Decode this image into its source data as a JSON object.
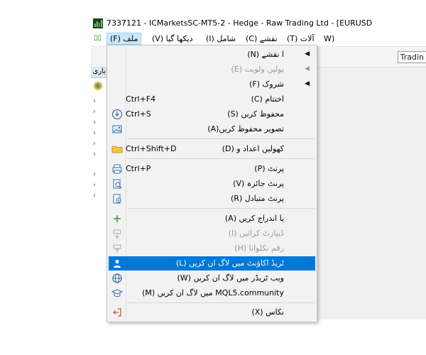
{
  "window": {
    "title": "7337121 - ICMarketsSC-MT5-2 - Hedge - Raw Trading Ltd - [EURUSD"
  },
  "menubar": {
    "items": [
      {
        "label": "ملف (F)",
        "active": true
      },
      {
        "label": "دیکھا گیا (V)"
      },
      {
        "label": "شامل (I)"
      },
      {
        "label": "نقشے (C)"
      },
      {
        "label": "آلات (T)"
      },
      {
        "label": "(W"
      }
    ]
  },
  "toolbar": {
    "fragment": "Tradin"
  },
  "panel": {
    "header": "باری"
  },
  "file_menu": {
    "items": [
      {
        "label": "ا نقشے (N)",
        "submenu": true,
        "disabled": false
      },
      {
        "label": "پولیں ولویت (E)",
        "submenu": true,
        "disabled": true
      },
      {
        "label": "شروک (F)",
        "submenu": true,
        "disabled": false
      },
      {
        "label": "اختتام (C)",
        "shortcut": "Ctrl+F4",
        "disabled": false
      },
      {
        "label": "محفوظ کریں (S)",
        "shortcut": "Ctrl+S",
        "icon": "save-icon"
      },
      {
        "label": "تصویر محفوظ کریں(A)",
        "icon": "picture-icon"
      },
      {
        "label": "کھولیں اعداد و (D)",
        "shortcut": "Ctrl+Shift+D",
        "icon": "folder-icon"
      },
      {
        "label": "پرنٹ (P)",
        "shortcut": "Ctrl+P",
        "icon": "printer-icon"
      },
      {
        "label": "پرنٹ جائزہ (V)",
        "icon": "print-preview-icon"
      },
      {
        "label": "پرنٹ متبادل (R)",
        "icon": "print-setup-icon"
      },
      {
        "label": "یا اندراج کریں (A)",
        "icon": "plus-icon"
      },
      {
        "label": "ڈیپازٹ کرائیں (I)",
        "icon": "deposit-icon",
        "disabled": true
      },
      {
        "label": "رقم نکلوانا (H)",
        "icon": "withdraw-icon",
        "disabled": true
      },
      {
        "label": "ٹریڈ اکاؤنٹ میں لاگ ان کریں (L)",
        "icon": "user-icon",
        "highlighted": true
      },
      {
        "label": "ویب ٹریڈر میں لاگ ان کریں (W)",
        "icon": "globe-icon"
      },
      {
        "label": "MQL5.community میں لاگ ان کریں (M)",
        "icon": "graduation-cap-icon"
      },
      {
        "label": "نکاس (X)",
        "icon": "exit-icon"
      }
    ]
  }
}
